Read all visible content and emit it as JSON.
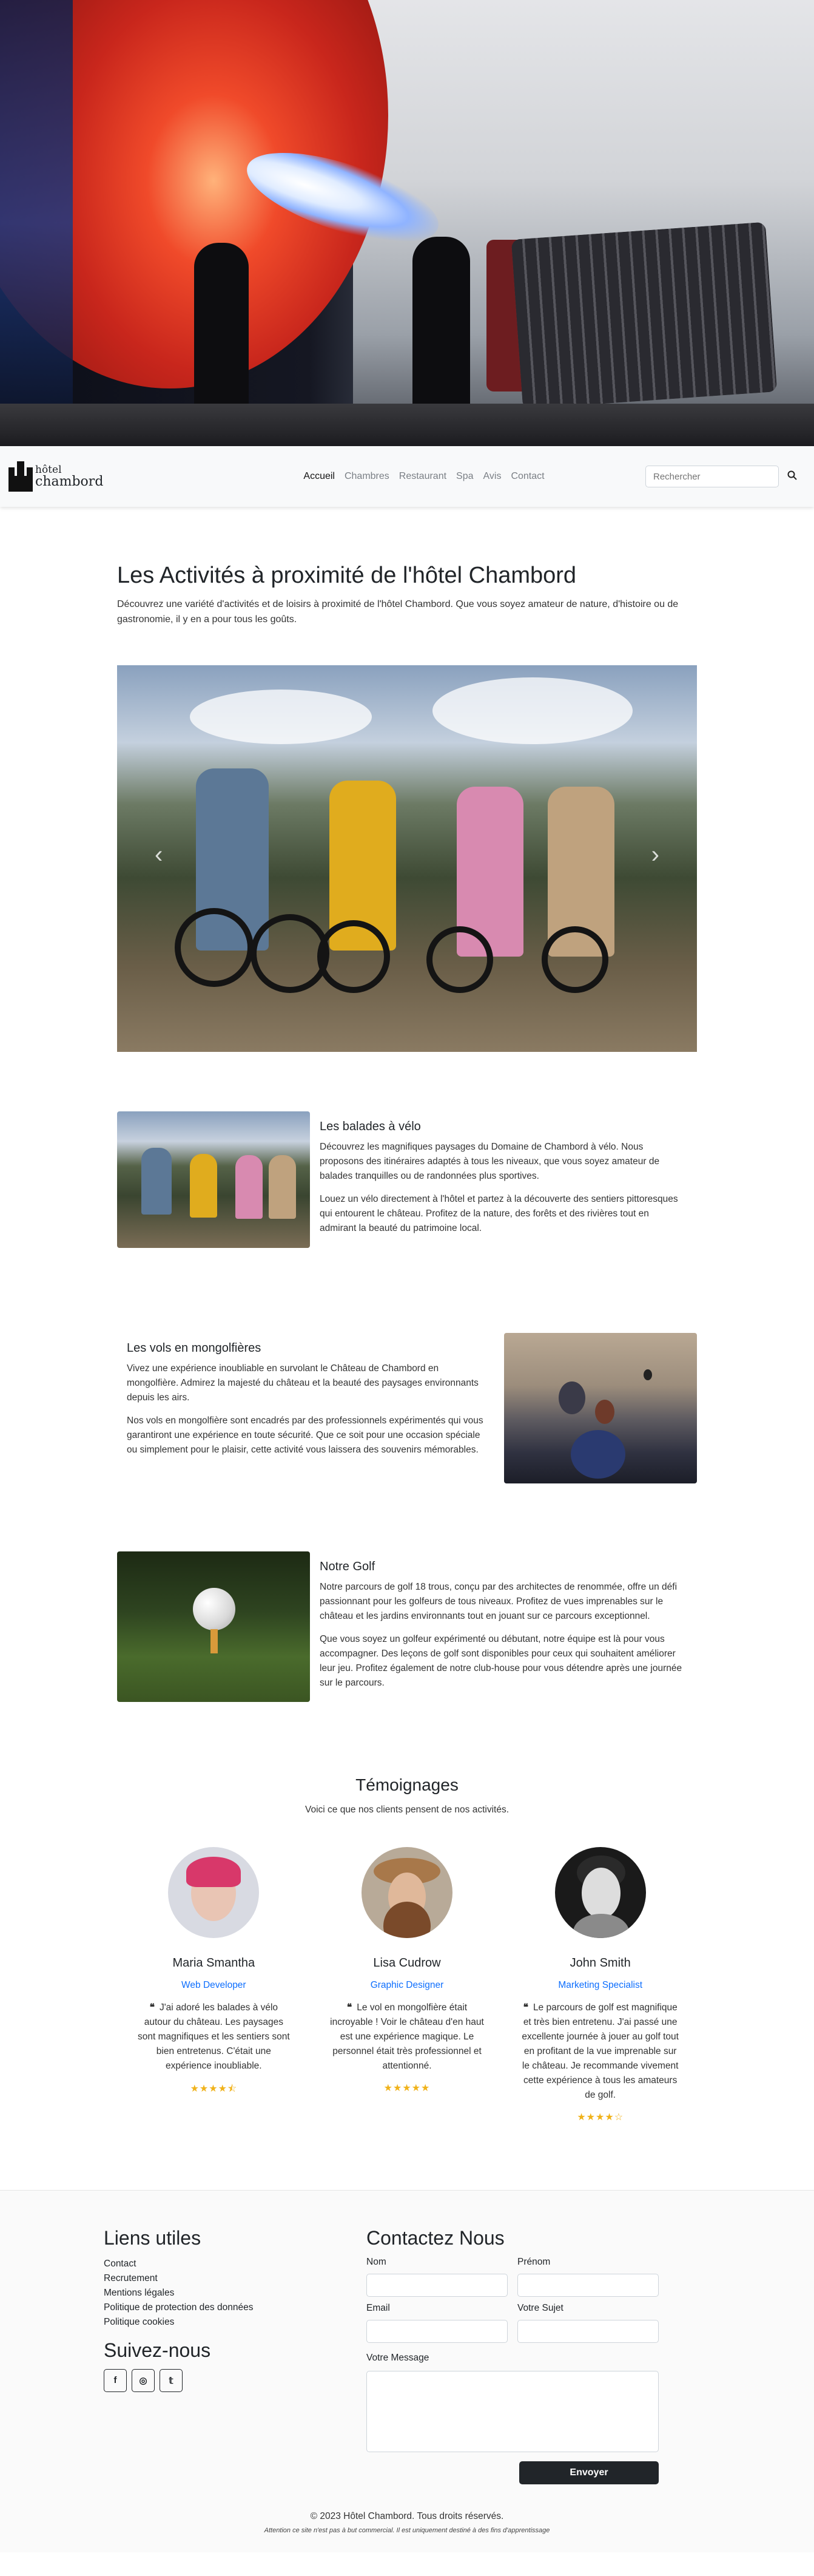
{
  "navbar": {
    "brand_line1": "hôtel",
    "brand_line2": "chambord",
    "links": [
      "Accueil",
      "Chambres",
      "Restaurant",
      "Spa",
      "Avis",
      "Contact"
    ],
    "search_placeholder": "Rechercher",
    "search_icon": "search-icon"
  },
  "intro": {
    "title": "Les Activités à proximité de l'hôtel Chambord",
    "text": "Découvrez une variété d'activités et de loisirs à proximité de l'hôtel Chambord. Que vous soyez amateur de nature, d'histoire ou de gastronomie, il y en a pour tous les goûts."
  },
  "carousel": {
    "prev_icon": "chevron-left-icon",
    "next_icon": "chevron-right-icon"
  },
  "activities": [
    {
      "title": "Les balades à vélo",
      "p1": "Découvrez les magnifiques paysages du Domaine de Chambord à vélo. Nous proposons des itinéraires adaptés à tous les niveaux, que vous soyez amateur de balades tranquilles ou de randonnées plus sportives.",
      "p2": "Louez un vélo directement à l'hôtel et partez à la découverte des sentiers pittoresques qui entourent le château. Profitez de la nature, des forêts et des rivières tout en admirant la beauté du patrimoine local."
    },
    {
      "title": "Les vols en mongolfières",
      "p1": "Vivez une expérience inoubliable en survolant le Château de Chambord en mongolfière. Admirez la majesté du château et la beauté des paysages environnants depuis les airs.",
      "p2": "Nos vols en mongolfière sont encadrés par des professionnels expérimentés qui vous garantiront une expérience en toute sécurité. Que ce soit pour une occasion spéciale ou simplement pour le plaisir, cette activité vous laissera des souvenirs mémorables."
    },
    {
      "title": "Notre Golf",
      "p1": "Notre parcours de golf 18 trous, conçu par des architectes de renommée, offre un défi passionnant pour les golfeurs de tous niveaux. Profitez de vues imprenables sur le château et les jardins environnants tout en jouant sur ce parcours exceptionnel.",
      "p2": "Que vous soyez un golfeur expérimenté ou débutant, notre équipe est là pour vous accompagner. Des leçons de golf sont disponibles pour ceux qui souhaitent améliorer leur jeu. Profitez également de notre club-house pour vous détendre après une journée sur le parcours."
    }
  ],
  "testimonials": {
    "title": "Témoignages",
    "lead": "Voici ce que nos clients pensent de nos activités.",
    "items": [
      {
        "name": "Maria Smantha",
        "role": "Web Developer",
        "quote": "J'ai adoré les balades à vélo autour du château. Les paysages sont magnifiques et les sentiers sont bien entretenus. C'était une expérience inoubliable.",
        "rating": 4.5,
        "stars": "★★★★⯪"
      },
      {
        "name": "Lisa Cudrow",
        "role": "Graphic Designer",
        "quote": "Le vol en mongolfière était incroyable ! Voir le château d'en haut est une expérience magique. Le personnel était très professionnel et attentionné.",
        "rating": 5,
        "stars": "★★★★★"
      },
      {
        "name": "John Smith",
        "role": "Marketing Specialist",
        "quote": "Le parcours de golf est magnifique et très bien entretenu. J'ai passé une excellente journée à jouer au golf tout en profitant de la vue imprenable sur le château. Je recommande vivement cette expérience à tous les amateurs de golf.",
        "rating": 4,
        "stars": "★★★★☆"
      }
    ]
  },
  "footer": {
    "links_title": "Liens utiles",
    "links": [
      "Contact",
      "Recrutement",
      "Mentions légales",
      "Politique de protection des données",
      "Politique cookies"
    ],
    "follow_title": "Suivez-nous",
    "socials": [
      {
        "icon": "facebook-icon",
        "glyph": "f"
      },
      {
        "icon": "instagram-icon",
        "glyph": "◎"
      },
      {
        "icon": "twitter-icon",
        "glyph": "𝕥"
      }
    ],
    "contact_title": "Contactez Nous",
    "field_nom": "Nom",
    "field_prenom": "Prénom",
    "field_email": "Email",
    "field_sujet": "Votre Sujet",
    "field_message": "Votre Message",
    "submit": "Envoyer",
    "copyright": "© 2023 Hôtel Chambord. Tous droits réservés.",
    "disclaimer": "Attention ce site n'est pas à but commercial. Il est uniquement destiné à des fins d'apprentissage"
  }
}
